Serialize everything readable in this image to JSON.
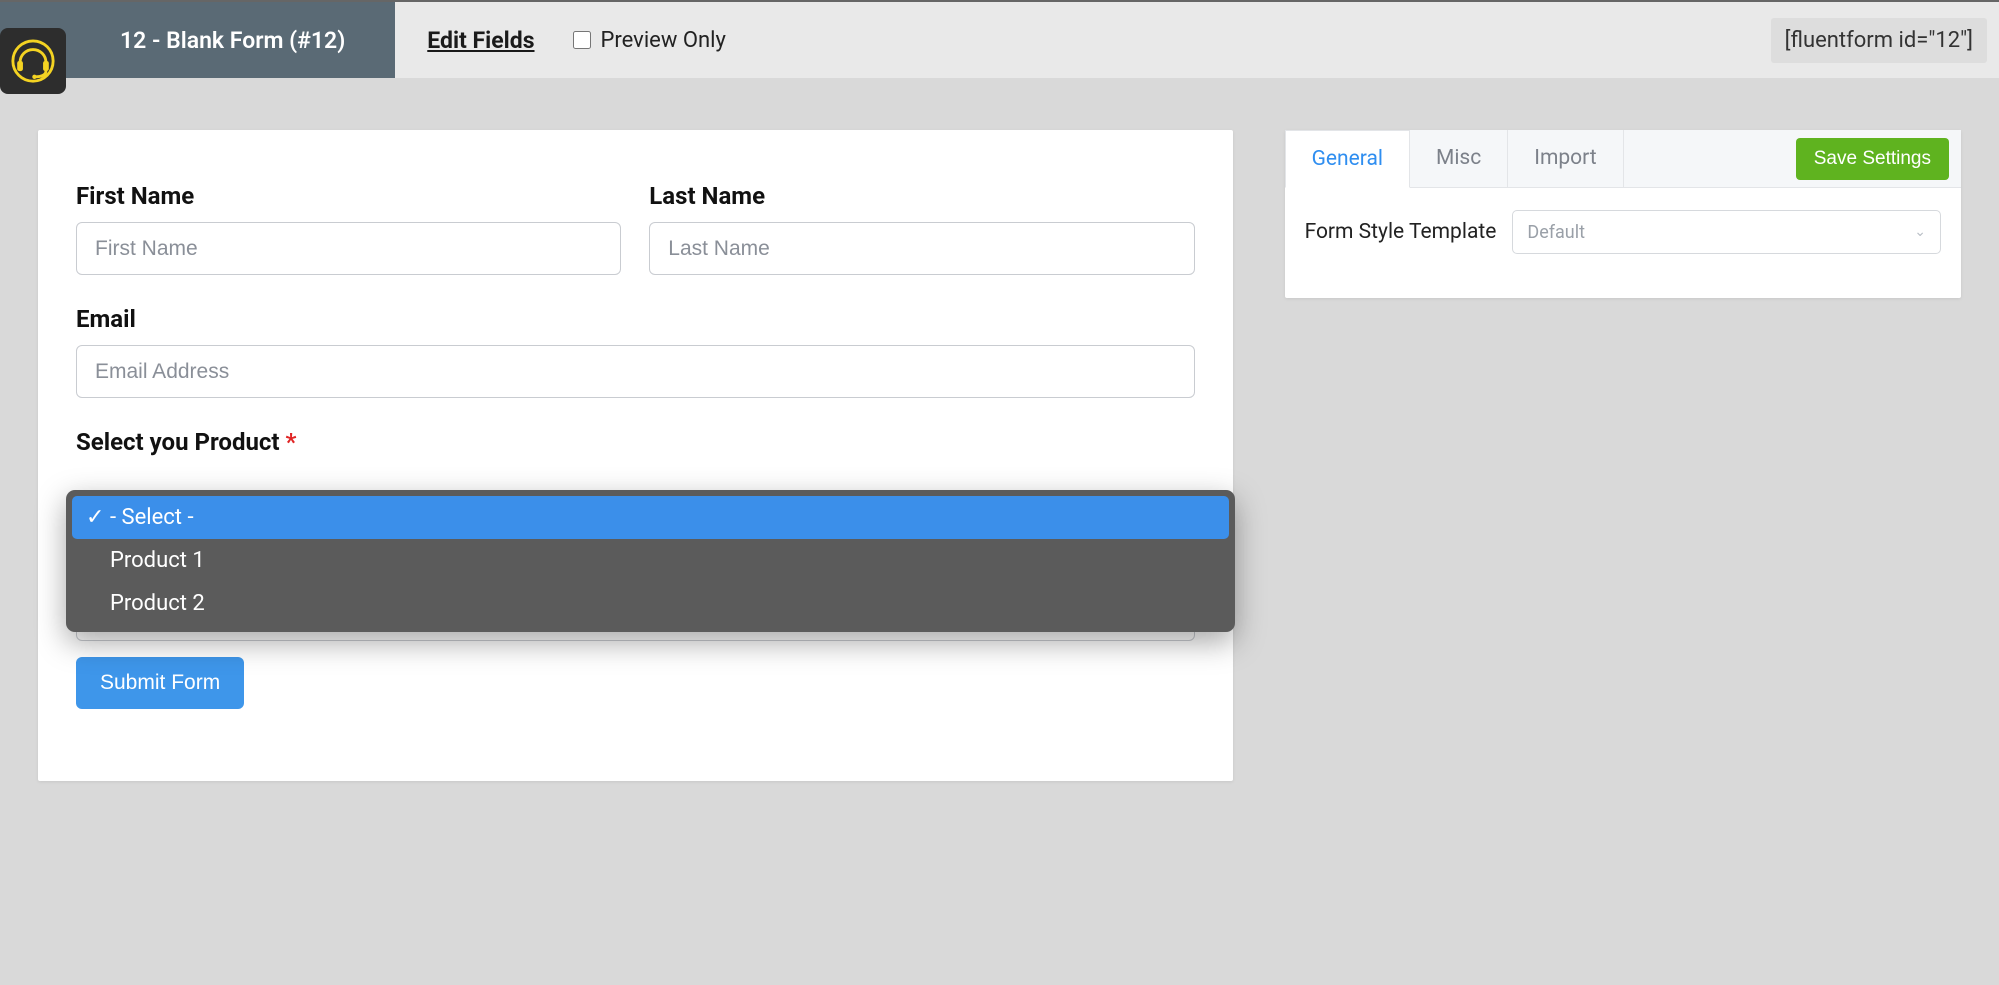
{
  "header": {
    "form_title": "12 - Blank Form (#12)",
    "edit_fields": "Edit Fields",
    "preview_only": "Preview Only",
    "shortcode": "[fluentform id=\"12\"]"
  },
  "form": {
    "first_name": {
      "label": "First Name",
      "placeholder": "First Name"
    },
    "last_name": {
      "label": "Last Name",
      "placeholder": "Last Name"
    },
    "email": {
      "label": "Email",
      "placeholder": "Email Address"
    },
    "product": {
      "label": "Select you Product"
    },
    "dropdown_options": [
      "- Select -",
      "Product 1",
      "Product 2"
    ],
    "submit": "Submit Form"
  },
  "sidebar": {
    "tabs": {
      "general": "General",
      "misc": "Misc",
      "import": "Import"
    },
    "save": "Save Settings",
    "form_style_label": "Form Style Template",
    "form_style_value": "Default"
  }
}
